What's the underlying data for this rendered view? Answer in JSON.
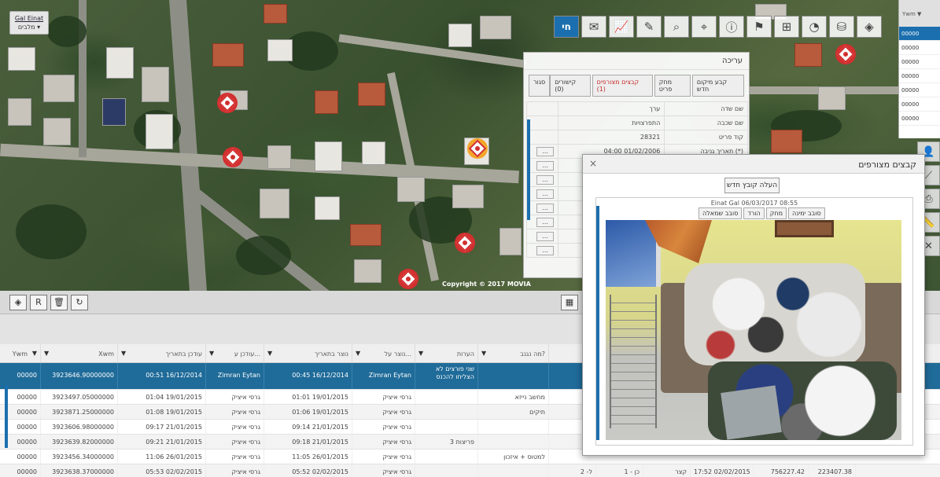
{
  "map": {
    "layer_selector": {
      "title": "Gal Einat",
      "subtitle": "מלבים ▾"
    },
    "copyright": "Copyright © 2017 MOVIA"
  },
  "toolbar": {
    "logo_label": "חי",
    "icons": [
      "mail-icon",
      "chart-icon",
      "pencil-icon",
      "search-icon",
      "pin-icon",
      "info-icon",
      "flag-icon",
      "org-chart-icon",
      "gauge-icon",
      "database-icon",
      "layers-icon"
    ]
  },
  "right_strip": {
    "header": "Ywm",
    "rows": [
      "00000",
      "00000",
      "00000",
      "00000",
      "00000",
      "00000",
      "00000"
    ]
  },
  "side_tools": [
    "person-icon",
    "ruler-icon",
    "print-icon",
    "measure-icon",
    "close-tools-icon"
  ],
  "edit_panel": {
    "title": "עריכה",
    "buttons": {
      "close": "סגור",
      "links": "קישורים (0)",
      "attached": "קבצים מצורפים (1)",
      "delete": "מחק פריט",
      "new_location": "קבע מיקום חדש"
    },
    "table": {
      "headers": {
        "field": "שם שדה",
        "value": "ערך"
      },
      "rows": [
        {
          "field": "שם שכבה",
          "value": "התפרצויות"
        },
        {
          "field": "קוד פריט",
          "value": "28321"
        },
        {
          "field": "תאריך גניבה (*)",
          "value": "04:00 01/02/2006"
        }
      ]
    }
  },
  "grid": {
    "toolbar_icons": [
      "layers-icon",
      "r-icon",
      "trash-icon",
      "refresh-icon"
    ],
    "columns": [
      "Ywm",
      "Xwm",
      "עודכן בתאריך",
      "עודכן ע...",
      "נוצר בתאריך",
      "נוצר על...",
      "הערות",
      "מה נגנב?"
    ],
    "rows": [
      {
        "ywm": "00000",
        "xwm": "3923646.90000000",
        "updated_at": "00:51 16/12/2014",
        "updated_by": "Zimran Eytan",
        "created_at": "00:45 16/12/2014",
        "created_by": "Zimran Eytan",
        "notes": "שני פורצים לא הצליחו להכנס",
        "stolen": ""
      },
      {
        "ywm": "00000",
        "xwm": "3923497.05000000",
        "updated_at": "01:04 19/01/2015",
        "updated_by": "גרסי איציק",
        "created_at": "01:01 19/01/2015",
        "created_by": "גרסי איציק",
        "notes": "",
        "stolen": "מחשב נייזא"
      },
      {
        "ywm": "00000",
        "xwm": "3923871.25000000",
        "updated_at": "01:08 19/01/2015",
        "updated_by": "גרסי איציק",
        "created_at": "01:06 19/01/2015",
        "created_by": "גרסי איציק",
        "notes": "",
        "stolen": "תיקים"
      },
      {
        "ywm": "00000",
        "xwm": "3923606.98000000",
        "updated_at": "09:17 21/01/2015",
        "updated_by": "גרסי איציק",
        "created_at": "09:14 21/01/2015",
        "created_by": "גרסי איציק",
        "notes": "",
        "stolen": ""
      },
      {
        "ywm": "00000",
        "xwm": "3923639.82000000",
        "updated_at": "09:21 21/01/2015",
        "updated_by": "גרסי איציק",
        "created_at": "09:18 21/01/2015",
        "created_by": "גרסי איציק",
        "notes": "3 פריצות",
        "stolen": ""
      },
      {
        "ywm": "00000",
        "xwm": "3923456.34000000",
        "updated_at": "11:06 26/01/2015",
        "updated_by": "גרסי איציק",
        "created_at": "11:05 26/01/2015",
        "created_by": "גרסי איציק",
        "notes": "",
        "stolen": "למטוס + איזכון"
      },
      {
        "ywm": "00000",
        "xwm": "3923638.37000000",
        "updated_at": "05:53 02/02/2015",
        "updated_by": "גרסי איציק",
        "created_at": "05:52 02/02/2015",
        "created_by": "גרסי איציק",
        "notes": "",
        "stolen": ""
      }
    ],
    "extra_last_row": {
      "c1": "ל‑ 2",
      "c2": "כן ‑ 1",
      "c3": "קצר",
      "c4": "17:52 02/02/2015",
      "c5": "756227.42",
      "c6": "223407.38"
    }
  },
  "files_dialog": {
    "title": "קבצים מצורפים",
    "upload_label": "העלה קובץ חדש",
    "file_caption": "Einat Gal 06/03/2017 08:55",
    "actions": [
      "סובב שמאלה",
      "הורד",
      "מחק",
      "סובב ימינה"
    ]
  }
}
